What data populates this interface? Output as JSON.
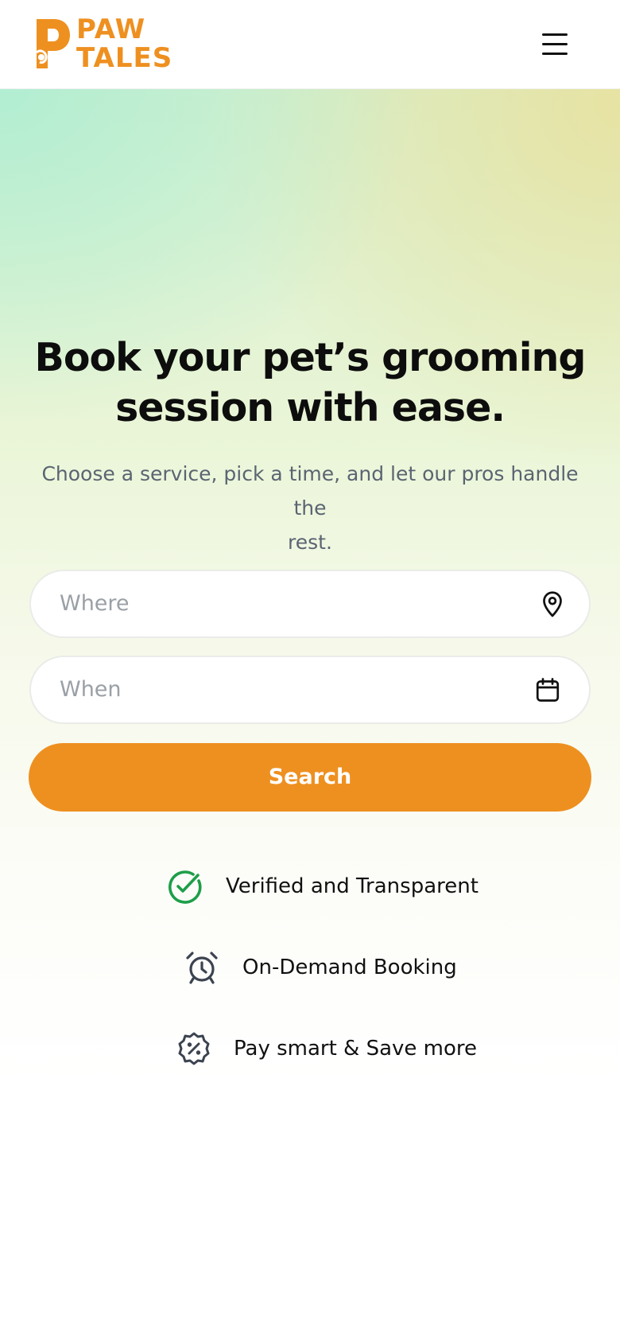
{
  "header": {
    "logo": {
      "line1": "PAW",
      "line2": "TALES"
    },
    "menu_icon": "hamburger-icon"
  },
  "hero": {
    "headline_line1": "Book your pet’s grooming",
    "headline_line2": "session with ease.",
    "subhead_line1": "Choose a service, pick a time, and let our pros handle the",
    "subhead_line2": "rest."
  },
  "search": {
    "where_placeholder": "Where",
    "where_icon": "location-pin-icon",
    "when_placeholder": "When",
    "when_icon": "calendar-icon",
    "button_label": "Search"
  },
  "features": [
    {
      "icon": "check-circle-icon",
      "label": "Verified and Transparent"
    },
    {
      "icon": "alarm-clock-icon",
      "label": "On-Demand Booking"
    },
    {
      "icon": "discount-badge-icon",
      "label": "Pay smart & Save more"
    }
  ],
  "colors": {
    "brand_orange": "#EE9020",
    "check_green": "#1e9e4a",
    "text_dark": "#0d0d0d",
    "text_muted": "#5b6472"
  }
}
